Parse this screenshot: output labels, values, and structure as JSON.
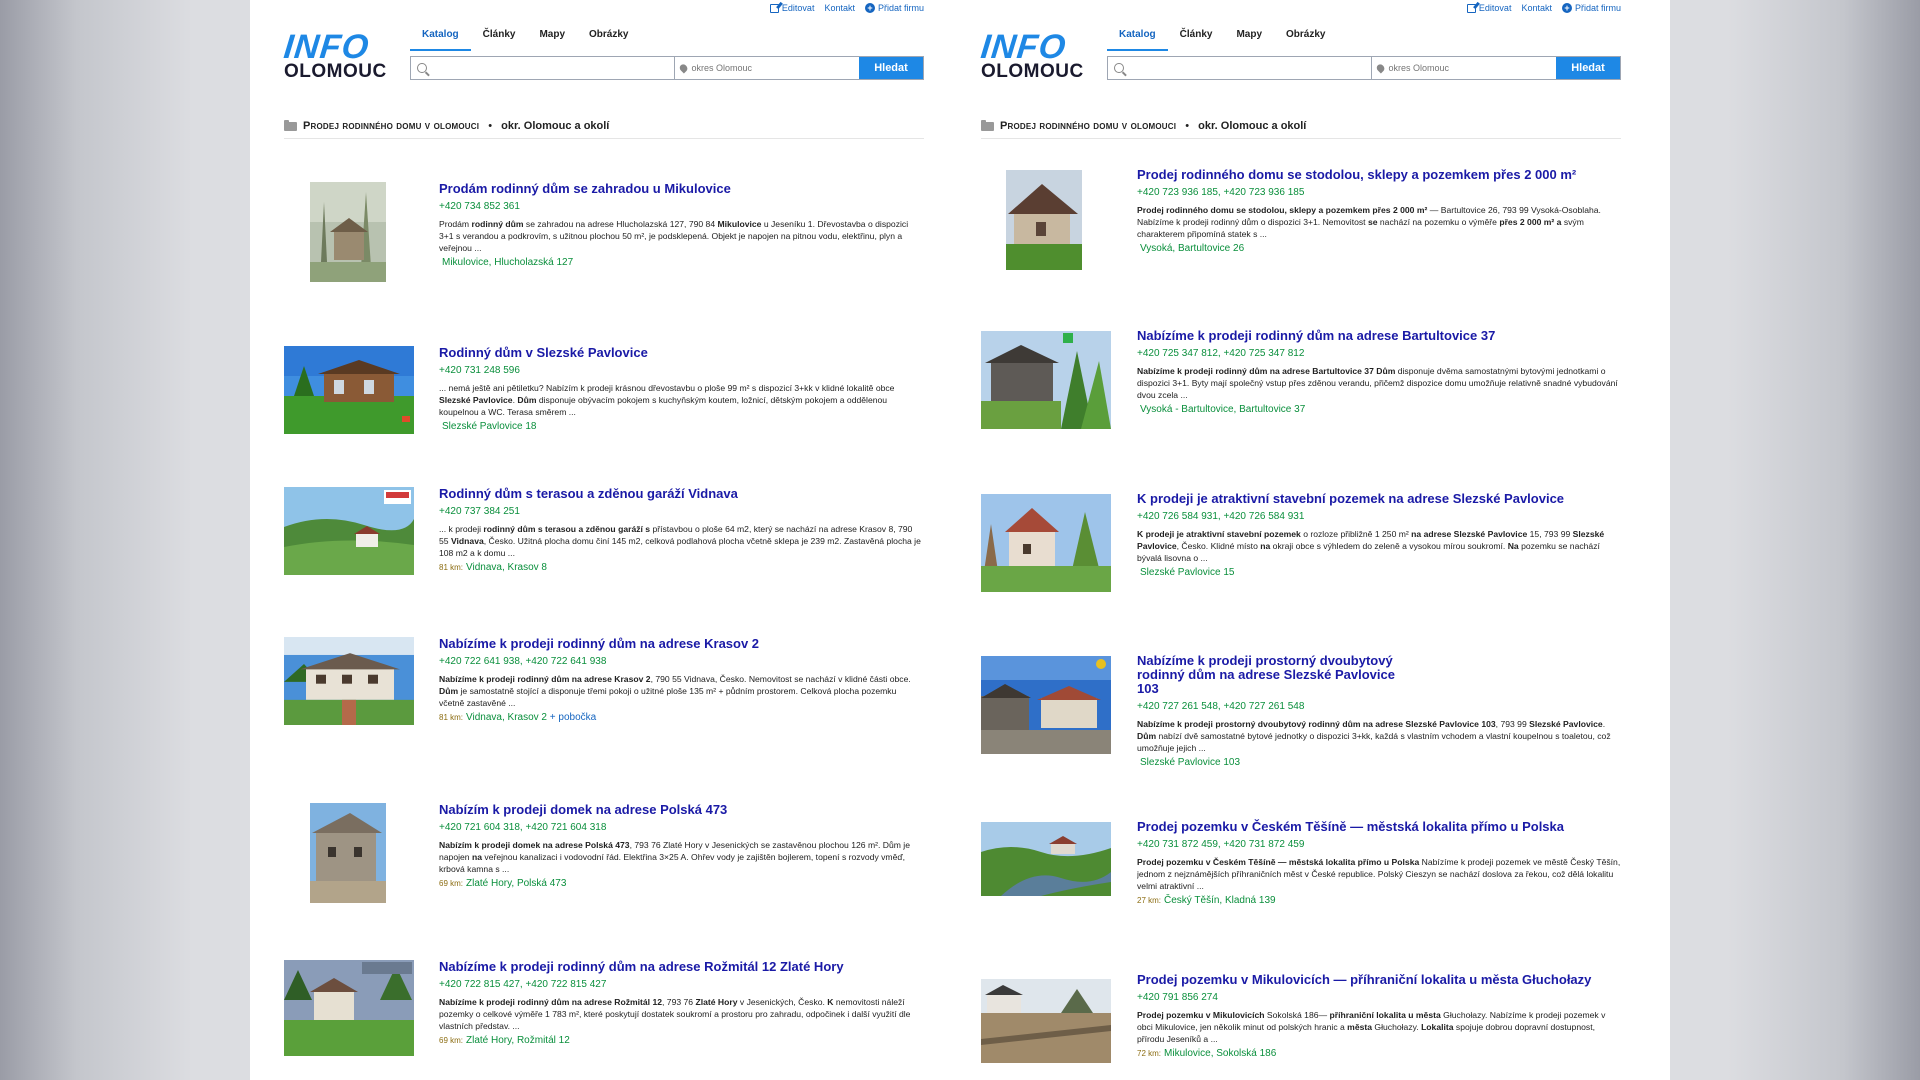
{
  "toplinks": {
    "edit": "Editovat",
    "contact": "Kontakt",
    "add": "Přidat firmu"
  },
  "logo": {
    "line1": "INFO",
    "line2": "OLOMOUC"
  },
  "tabs": [
    "Katalog",
    "Články",
    "Mapy",
    "Obrázky"
  ],
  "search": {
    "query_value": "",
    "location_placeholder": "okres Olomouc",
    "button": "Hledat"
  },
  "breadcrumb": {
    "category": "Prodej rodinného domu v olomouci",
    "separator": " • ",
    "region": "okr. Olomouc a okolí"
  },
  "left_items": [
    {
      "title": "Prodám rodinný dům se zahradou u Mikulovice",
      "phone": "+420 734 852 361",
      "desc_html": "Prodám <b>rodinný dům</b> se zahradou na adrese Hlucholazská 127, 790 84 <b>Mikulovice</b> u Jeseníku 1. Dřevostavba o dispozici 3+1 s verandou a podkrovím, s užitnou plochou 50 m², je podsklepená. Objekt je napojen na pitnou vodu, elektřinu, plyn a veřejnou ...",
      "km": "",
      "address": "Mikulovice, Hlucholazská 127",
      "branch": ""
    },
    {
      "title": "Rodinný dům v Slezské Pavlovice",
      "phone": "+420 731 248 596",
      "desc_html": "... nemá ještě ani pětiletku? Nabízím k prodeji krásnou dřevostavbu o ploše 99 m² s dispozicí 3+kk v klidné lokalitě obce <b>Slezské Pavlovice</b>. <b>Dům</b> disponuje obývacím pokojem s kuchyňským koutem, ložnicí, dětským pokojem a oddělenou koupelnou a WC. Terasa směrem ...",
      "km": "",
      "address": "Slezské Pavlovice 18",
      "branch": ""
    },
    {
      "title": "Rodinný dům s terasou a zděnou garáží Vidnava",
      "phone": "+420 737 384 251",
      "desc_html": "... k prodeji <b>rodinný dům s terasou a zděnou garáží s</b> přístavbou o ploše 64 m2, který se nachází na adrese Krasov 8, 790 55 <b>Vidnava</b>, Česko. Užitná plocha domu činí 145 m2, celková podlahová plocha včetně sklepa je 239 m2. Zastavěná plocha je 108 m2 a k domu ...",
      "km": "81 km:",
      "address": "Vidnava, Krasov 8",
      "branch": ""
    },
    {
      "title": "Nabízíme k prodeji rodinný dům na adrese Krasov 2",
      "phone": "+420 722 641 938, +420 722 641 938",
      "desc_html": "<b>Nabízíme k prodeji rodinný dům na adrese Krasov 2</b>, 790 55 Vidnava, Česko. Nemovitost se nachází v klidné části obce. <b>Dům</b> je samostatně stojící a disponuje třemi pokoji o užitné ploše 135 m² + půdním prostorem. Celková plocha pozemku včetně zastavěné ...",
      "km": "81 km:",
      "address": "Vidnava, Krasov 2",
      "branch": "+ pobočka"
    },
    {
      "title": "Nabízím k prodeji domek na adrese Polská 473",
      "phone": "+420 721 604 318, +420 721 604 318",
      "desc_html": "<b>Nabízím k prodeji domek na adrese Polská 473</b>, 793 76 Zlaté Hory v Jesenických se zastavěnou plochou 126 m². Dům je napojen <b>na</b> veřejnou kanalizaci i vodovodní řád. Elektřina 3×25 A. Ohřev vody je zajištěn bojlerem, topení s rozvody vměď, krbová kamna s ...",
      "km": "69 km:",
      "address": "Zlaté Hory, Polská 473",
      "branch": ""
    },
    {
      "title": "Nabízíme k prodeji rodinný dům na adrese Rožmitál 12 Zlaté Hory",
      "phone": "+420 722 815 427, +420 722 815 427",
      "desc_html": "<b>Nabízíme k prodeji rodinný dům na adrese Rožmitál 12</b>, 793 76 <b>Zlaté Hory</b> v Jesenických, Česko. <b>K</b> nemovitosti náleží pozemky o celkové výměře 1 783 m², které poskytují dostatek soukromí a prostoru pro zahradu, odpočinek i další využití dle vlastních představ. ...",
      "km": "69 km:",
      "address": "Zlaté Hory, Rožmitál 12",
      "branch": ""
    }
  ],
  "right_items": [
    {
      "title": "Prodej rodinného domu se stodolou, sklepy a pozemkem přes 2 000 m²",
      "phone": "+420 723 936 185, +420 723 936 185",
      "desc_html": "<b>Prodej rodinného domu se stodolou, sklepy a pozemkem přes 2 000 m²</b> — Bartultovice 26, 793 99 Vysoká-Osoblaha. Nabízíme k prodeji rodinný dům o dispozici 3+1. Nemovitost <b>se</b> nachází na pozemku o výměře <b>přes 2 000 m² a</b> svým charakterem připomíná statek s ...",
      "km": "",
      "address": "Vysoká, Bartultovice 26",
      "branch": ""
    },
    {
      "title": "Nabízíme k prodeji rodinný dům na adrese Bartultovice 37",
      "phone": "+420 725 347 812, +420 725 347 812",
      "desc_html": "<b>Nabízíme k prodeji rodinný dům na adrese Bartultovice 37 Dům</b> disponuje dvěma samostatnými bytovými jednotkami o dispozici 3+1. Byty mají společný vstup přes zděnou verandu, přičemž dispozice domu umožňuje relativně snadné vybudování dvou zcela ...",
      "km": "",
      "address": "Vysoká - Bartultovice, Bartultovice 37",
      "branch": ""
    },
    {
      "title": "K prodeji je atraktivní stavební pozemek na adrese Slezské Pavlovice",
      "phone": "+420 726 584 931, +420 726 584 931",
      "desc_html": "<b>K prodeji je atraktivní stavební pozemek</b> o rozloze přibližně 1 250 m² <b>na adrese Slezské Pavlovice</b> 15, 793 99 <b>Slezské Pavlovice</b>, Česko. Klidné místo <b>na</b> okraji obce s výhledem do zeleně a vysokou mírou soukromí. <b>Na</b> pozemku se nachází bývalá lisovna o ...",
      "km": "",
      "address": "Slezské Pavlovice 15",
      "branch": ""
    },
    {
      "title": "Nabízíme k prodeji prostorný dvoubytový rodinný dům na adrese Slezské Pavlovice 103",
      "phone": "+420 727 261 548, +420 727 261 548",
      "desc_html": "<b>Nabízíme k prodeji prostorný dvoubytový rodinný dům na adrese Slezské Pavlovice 103</b>, 793 99 <b>Slezské Pavlovice</b>. <b>Dům</b> nabízí dvě samostatné bytové jednotky o dispozici 3+kk, každá s vlastním vchodem a vlastní koupelnou s toaletou, což umožňuje jejich ...",
      "km": "",
      "address": "Slezské Pavlovice 103",
      "branch": ""
    },
    {
      "title": "Prodej pozemku v Českém Těšíně — městská lokalita přímo u Polska",
      "phone": "+420 731 872 459, +420 731 872 459",
      "desc_html": "<b>Prodej pozemku v Českém Těšíně — městská lokalita přímo u Polska</b> Nabízíme k prodeji pozemek ve městě Český Těšín, jednom z nejznámějších příhraničních měst v České republice. Polský Cieszyn se nachází doslova za řekou, což dělá lokalitu velmi atraktivní ...",
      "km": "27 km:",
      "address": "Český Těšín, Kladná 139",
      "branch": ""
    },
    {
      "title": "Prodej pozemku v Mikulovicích — příhraniční lokalita u města Głuchołazy",
      "phone": "+420 791 856 274",
      "desc_html": "<b>Prodej pozemku v Mikulovicích</b> Sokolská 186— <b>příhraniční lokalita u města</b> Głuchołazy. Nabízíme k prodeji pozemek v obci Mikulovice, jen několik minut od polských hranic a <b>města</b> Głuchołazy. <b>Lokalita</b> spojuje dobrou dopravní dostupnost, přírodu Jeseníků a ...",
      "km": "72 km:",
      "address": "Mikulovice, Sokolská 186",
      "branch": ""
    }
  ],
  "colors": {
    "link": "#1a1aa6",
    "green": "#0a8f3c",
    "accent": "#1e88e5"
  },
  "icons": [
    "edit-icon",
    "plus-circle-icon",
    "search-icon",
    "location-pin-icon",
    "folder-icon"
  ]
}
